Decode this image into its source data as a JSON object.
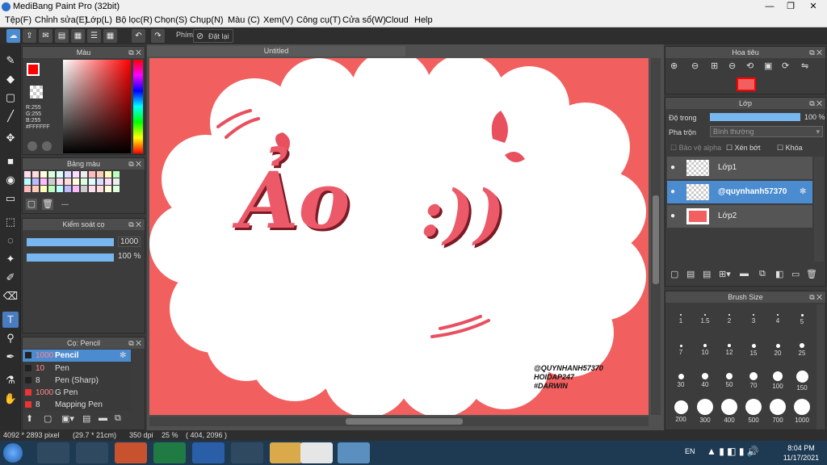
{
  "app": {
    "title": "MediBang Paint Pro (32bit)"
  },
  "window_controls": {
    "minimize": "—",
    "maximize": "❐",
    "close": "✕"
  },
  "menu": [
    "Tệp(F)",
    "Chỉnh sửa(E)",
    "Lớp(L)",
    "Bộ lọc(R)",
    "Chọn(S)",
    "Chụp(N)",
    "Màu (C)",
    "Xem(V)",
    "Công cụ(T)",
    "Cửa sổ(W)",
    "Cloud",
    "Help"
  ],
  "toolbar": {
    "key_label": "Phím",
    "reset_label": "Đặt lại"
  },
  "color_panel": {
    "title": "Màu",
    "r": "R:255",
    "g": "G:255",
    "b": "B:255",
    "hex": "#FFFFFF",
    "primary": "#ff0000",
    "secondary": "#ffffff"
  },
  "palette_panel": {
    "title": "Bảng màu",
    "extra": "---"
  },
  "brush_control": {
    "title": "Kiểm soát cọ",
    "size_value": "1000",
    "opacity_value": "100 %"
  },
  "brush_list": {
    "title": "Cọ: Pencil",
    "items": [
      {
        "size": "1000",
        "name": "Pencil"
      },
      {
        "size": "10",
        "name": "Pen"
      },
      {
        "size": "8",
        "name": "Pen (Sharp)"
      },
      {
        "size": "1000",
        "name": "G Pen"
      },
      {
        "size": "8",
        "name": "Mapping Pen"
      }
    ]
  },
  "document": {
    "tab": "Untitled"
  },
  "artwork": {
    "main_text": "Ảo",
    "emoji_text": ":))",
    "watermark": [
      "@QUYNHANH57370",
      "HOIDAP247",
      "#DARWIN"
    ]
  },
  "navigator": {
    "title": "Hoa tiêu"
  },
  "layer_panel": {
    "title": "Lớp",
    "opacity_label": "Độ trong",
    "opacity_value": "100 %",
    "blend_label": "Pha trộn",
    "blend_value": "Bình thường",
    "protect_alpha": "Bảo vệ alpha",
    "clipping": "Xén bớt",
    "lock": "Khóa",
    "layers": [
      "Lớp1",
      "@quynhanh57370",
      "Lớp2"
    ]
  },
  "brush_size": {
    "title": "Brush Size",
    "sizes": [
      "1",
      "1.5",
      "2",
      "3",
      "4",
      "5",
      "7",
      "10",
      "12",
      "15",
      "20",
      "25",
      "30",
      "40",
      "50",
      "70",
      "100",
      "150",
      "200",
      "300",
      "400",
      "500",
      "700",
      "1000"
    ]
  },
  "status": {
    "size": "4092 * 2893 pixel",
    "cm": "(29.7 * 21cm)",
    "dpi": "350 dpi",
    "zoom": "25 %",
    "coords": "( 404, 2096 )"
  },
  "taskbar": {
    "lang": "EN",
    "time": "8:04 PM",
    "date": "11/17/2021"
  }
}
